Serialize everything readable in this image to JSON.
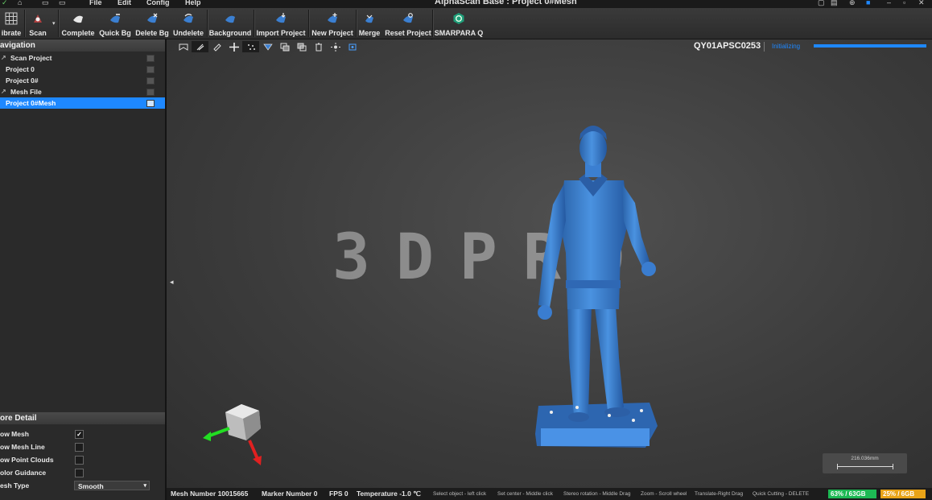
{
  "titlebar": {
    "title": "AlphaScan Base : Project 0#Mesh",
    "menu": [
      "File",
      "Edit",
      "Config",
      "Help"
    ]
  },
  "toolbar": {
    "buttons": [
      {
        "label": "ibrate",
        "icon": "calibrate-grid-icon"
      },
      {
        "label": "Scan",
        "icon": "scan-icon"
      },
      {
        "label": "Complete",
        "icon": "complete-icon"
      },
      {
        "label": "Quick Bg",
        "icon": "quick-bg-icon"
      },
      {
        "label": "Delete Bg",
        "icon": "delete-bg-icon"
      },
      {
        "label": "Undelete",
        "icon": "undelete-icon"
      },
      {
        "label": "Background",
        "icon": "background-icon"
      },
      {
        "label": "Import Project",
        "icon": "import-project-icon"
      },
      {
        "label": "New Project",
        "icon": "new-project-icon"
      },
      {
        "label": "Merge",
        "icon": "merge-icon"
      },
      {
        "label": "Reset Project",
        "icon": "reset-project-icon"
      },
      {
        "label": "SMARPARA Q",
        "icon": "smarpara-logo-icon"
      }
    ]
  },
  "navigation": {
    "title": "avigation",
    "items": [
      {
        "label": "Scan Project",
        "selected": false
      },
      {
        "label": "Project 0",
        "selected": false
      },
      {
        "label": "Project 0#",
        "selected": false
      },
      {
        "label": "Mesh File",
        "selected": false
      },
      {
        "label": "Project 0#Mesh",
        "selected": true
      }
    ]
  },
  "more_detail": {
    "title": "ore Detail",
    "rows": [
      {
        "label": "ow Mesh",
        "checked": true
      },
      {
        "label": "ow Mesh Line",
        "checked": false
      },
      {
        "label": "ow Point Clouds",
        "checked": false
      },
      {
        "label": "olor Guidance",
        "checked": false
      }
    ],
    "mesh_type_label": "esh Type",
    "mesh_type_value": "Smooth"
  },
  "viewport": {
    "serial": "QY01APSC0253",
    "status": "Initializing",
    "progress": 1.0,
    "watermark": "3DPRO",
    "scale_text": "216.036mm"
  },
  "statusbar": {
    "mesh_number": "Mesh Number  10015665",
    "marker_number": "Marker Number  0",
    "fps": "FPS  0",
    "temperature": "Temperature  -1.0 ℃",
    "hints": [
      "Select object - left click",
      "Set center - Middle click",
      "Stereo rotation - Middle Drag",
      "Zoom - Scroll wheel",
      "Translate-Right Drag",
      "Quick Cutting - DELETE"
    ],
    "mem1": "63% / 63GB",
    "mem2": "25% / 6GB"
  },
  "colors": {
    "accent": "#1e88ff",
    "mesh": "#3b7fd1",
    "mem1": "#1db954",
    "mem2": "#e8a317"
  }
}
